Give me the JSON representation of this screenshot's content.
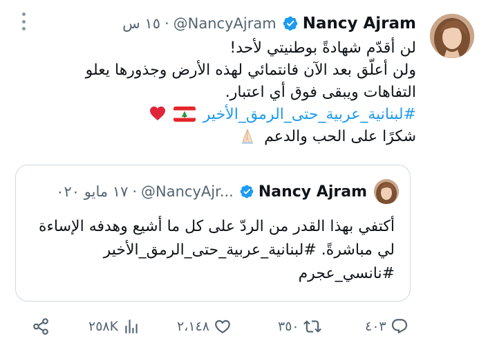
{
  "tweet": {
    "author_name": "Nancy Ajram",
    "handle": "@NancyAjram",
    "separator": "·",
    "time": "١٥ س",
    "lines": [
      "لن أقدّم شهادةً بوطنيتي لأحد!",
      "ولن أعلّق بعد الآن فانتمائي لهذه الأرض وجذورها يعلو",
      "التفاهات ويبقى فوق أي اعتبار."
    ],
    "hashtag": "#لبنانية_عربية_حتى_الرمق_الأخير",
    "thanks": "شكرًا على الحب والدعم"
  },
  "quote": {
    "author_name": "Nancy Ajram",
    "handle": "@NancyAjr...",
    "separator": "·",
    "time": "١٧ مايو ٠٢٠",
    "lines": [
      "أكتفي بهذا القدر من الردّ على كل ما أشيع وهدفه الإساءة",
      "لي مباشرةً. #لبنانية_عربية_حتى_الرمق_الأخير",
      "#نانسي_عجرم"
    ]
  },
  "actions": {
    "replies": "٤٠٣",
    "retweets": "٣٥٠",
    "likes": "٢،١٤٨",
    "views": "٢٥٨K"
  },
  "icons": {
    "verified": "verified-badge-icon",
    "more": "more-icon",
    "reply": "reply-icon",
    "retweet": "retweet-icon",
    "like": "heart-icon",
    "views": "views-icon",
    "share": "share-icon",
    "flag": "lebanon-flag-icon",
    "heart_emoji": "red-heart-icon",
    "pray": "praying-hands-icon"
  },
  "colors": {
    "accent": "#1d9bf0",
    "text": "#0f1419",
    "secondary": "#536471",
    "border": "#cfd9de"
  }
}
